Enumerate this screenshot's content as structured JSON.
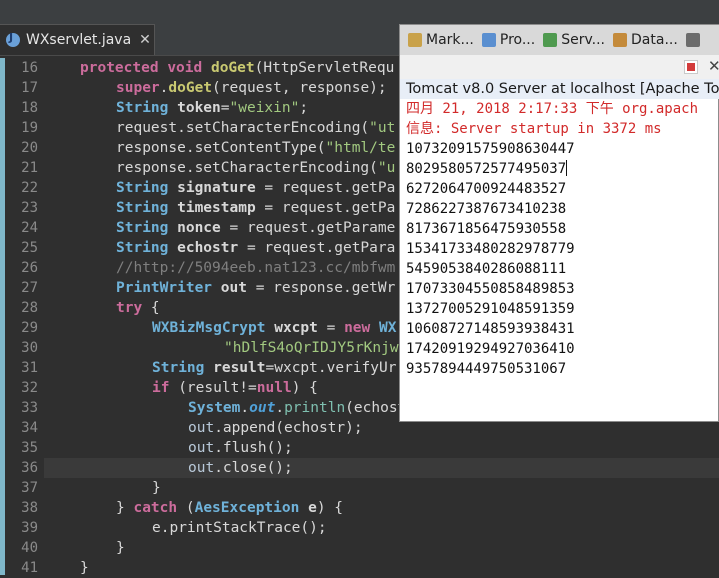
{
  "editor": {
    "tab_label": "WXservlet.java",
    "tab_close": "✕",
    "lines": [
      {
        "num": "16",
        "tokens": [
          [
            "kw",
            "protected "
          ],
          [
            "kw",
            "void "
          ],
          [
            "method",
            "doGet"
          ],
          [
            "plain",
            "(HttpServletRequ"
          ]
        ]
      },
      {
        "num": "17",
        "tokens": [
          [
            "kw",
            "super"
          ],
          [
            "plain",
            "."
          ],
          [
            "method",
            "doGet"
          ],
          [
            "plain",
            "(request, response);"
          ]
        ]
      },
      {
        "num": "18",
        "tokens": [
          [
            "type",
            "String "
          ],
          [
            "var",
            "token"
          ],
          [
            "plain",
            "="
          ],
          [
            "str",
            "\"weixin\""
          ],
          [
            "plain",
            ";"
          ]
        ]
      },
      {
        "num": "19",
        "tokens": [
          [
            "plain",
            "request.setCharacterEncoding("
          ],
          [
            "str",
            "\"ut"
          ]
        ]
      },
      {
        "num": "20",
        "tokens": [
          [
            "plain",
            "response.setContentType("
          ],
          [
            "str",
            "\"html/te"
          ]
        ]
      },
      {
        "num": "21",
        "tokens": [
          [
            "plain",
            "response.setCharacterEncoding("
          ],
          [
            "str",
            "\"u"
          ]
        ]
      },
      {
        "num": "22",
        "tokens": [
          [
            "type",
            "String "
          ],
          [
            "var",
            "signature"
          ],
          [
            "plain",
            " = request.getPa"
          ]
        ]
      },
      {
        "num": "23",
        "tokens": [
          [
            "type",
            "String "
          ],
          [
            "var",
            "timestamp"
          ],
          [
            "plain",
            " = request.getPa"
          ]
        ]
      },
      {
        "num": "24",
        "tokens": [
          [
            "type",
            "String "
          ],
          [
            "var",
            "nonce"
          ],
          [
            "plain",
            " = request.getParame"
          ]
        ]
      },
      {
        "num": "25",
        "tokens": [
          [
            "type",
            "String "
          ],
          [
            "var",
            "echostr"
          ],
          [
            "plain",
            " = request.getPara"
          ]
        ]
      },
      {
        "num": "26",
        "tokens": [
          [
            "comment",
            "//http://5094eeb.nat123.cc/mbfwm"
          ]
        ]
      },
      {
        "num": "27",
        "tokens": [
          [
            "type",
            "PrintWriter "
          ],
          [
            "var",
            "out"
          ],
          [
            "plain",
            " = response.getWr"
          ]
        ]
      },
      {
        "num": "28",
        "tokens": [
          [
            "kw",
            "try "
          ],
          [
            "plain",
            "{"
          ]
        ]
      },
      {
        "num": "29",
        "tokens": [
          [
            "type",
            "WXBizMsgCrypt "
          ],
          [
            "var",
            "wxcpt"
          ],
          [
            "plain",
            " = "
          ],
          [
            "kw",
            "new "
          ],
          [
            "type",
            "WX"
          ]
        ]
      },
      {
        "num": "30",
        "tokens": [
          [
            "str",
            "\"hDlfS4oQrIDJY5rKnjw"
          ]
        ]
      },
      {
        "num": "31",
        "tokens": [
          [
            "type",
            "String "
          ],
          [
            "var",
            "result"
          ],
          [
            "plain",
            "=wxcpt.verifyUr"
          ]
        ]
      },
      {
        "num": "32",
        "tokens": [
          [
            "kw",
            "if "
          ],
          [
            "plain",
            "(result!="
          ],
          [
            "kw",
            "null"
          ],
          [
            "plain",
            ") {"
          ]
        ]
      },
      {
        "num": "33",
        "tokens": [
          [
            "type",
            "System"
          ],
          [
            "plain",
            "."
          ],
          [
            "static-field",
            "out"
          ],
          [
            "plain",
            "."
          ],
          [
            "call",
            "println"
          ],
          [
            "plain",
            "(echost"
          ]
        ]
      },
      {
        "num": "34",
        "tokens": [
          [
            "field",
            "out"
          ],
          [
            "plain",
            ".append(echostr);"
          ]
        ]
      },
      {
        "num": "35",
        "tokens": [
          [
            "field",
            "out"
          ],
          [
            "plain",
            ".flush();"
          ]
        ]
      },
      {
        "num": "36",
        "tokens": [
          [
            "field",
            "out"
          ],
          [
            "plain",
            ".close();"
          ]
        ]
      },
      {
        "num": "37",
        "tokens": [
          [
            "plain",
            "}"
          ]
        ]
      },
      {
        "num": "38",
        "tokens": [
          [
            "plain",
            "} "
          ],
          [
            "kw",
            "catch "
          ],
          [
            "plain",
            "("
          ],
          [
            "type",
            "AesException "
          ],
          [
            "var",
            "e"
          ],
          [
            "plain",
            ") {"
          ]
        ]
      },
      {
        "num": "39",
        "tokens": [
          [
            "plain",
            "e.printStackTrace();"
          ]
        ]
      },
      {
        "num": "40",
        "tokens": [
          [
            "plain",
            "}"
          ]
        ]
      },
      {
        "num": "41",
        "tokens": [
          [
            "plain",
            "}"
          ]
        ]
      }
    ]
  },
  "views": {
    "tabs": [
      {
        "label": "Mark...",
        "icon": "markers-icon",
        "color": "#c9a24a"
      },
      {
        "label": "Pro...",
        "icon": "properties-icon",
        "color": "#5a8fd0"
      },
      {
        "label": "Serv...",
        "icon": "servers-icon",
        "color": "#4f9a4f"
      },
      {
        "label": "Data...",
        "icon": "data-source-icon",
        "color": "#c48a3a"
      },
      {
        "label": "",
        "icon": "snippets-icon",
        "color": "#6c6c6c"
      }
    ],
    "close_symbol": "✕"
  },
  "console": {
    "title": "Tomcat v8.0 Server at localhost [Apache To",
    "log_lines": [
      "四月 21, 2018 2:17:33 下午 org.apach",
      "信息: Server startup in 3372 ms"
    ],
    "output_lines": [
      "10732091575908630447",
      "8029580572577495037",
      "6272064700924483527",
      "7286227387673410238",
      "8173671856475930558",
      "15341733480282978779",
      "5459053840286088111",
      "17073304550858489853",
      "13727005291048591359",
      "10608727148593938431",
      "17420919294927036410",
      "9357894449750531067"
    ]
  },
  "colors": {
    "editor_bg": "#2f2f2f",
    "keyword": "#cc6c9c",
    "type": "#6fb2d9",
    "string": "#a2c980",
    "console_log_red": "#d22a2a"
  }
}
